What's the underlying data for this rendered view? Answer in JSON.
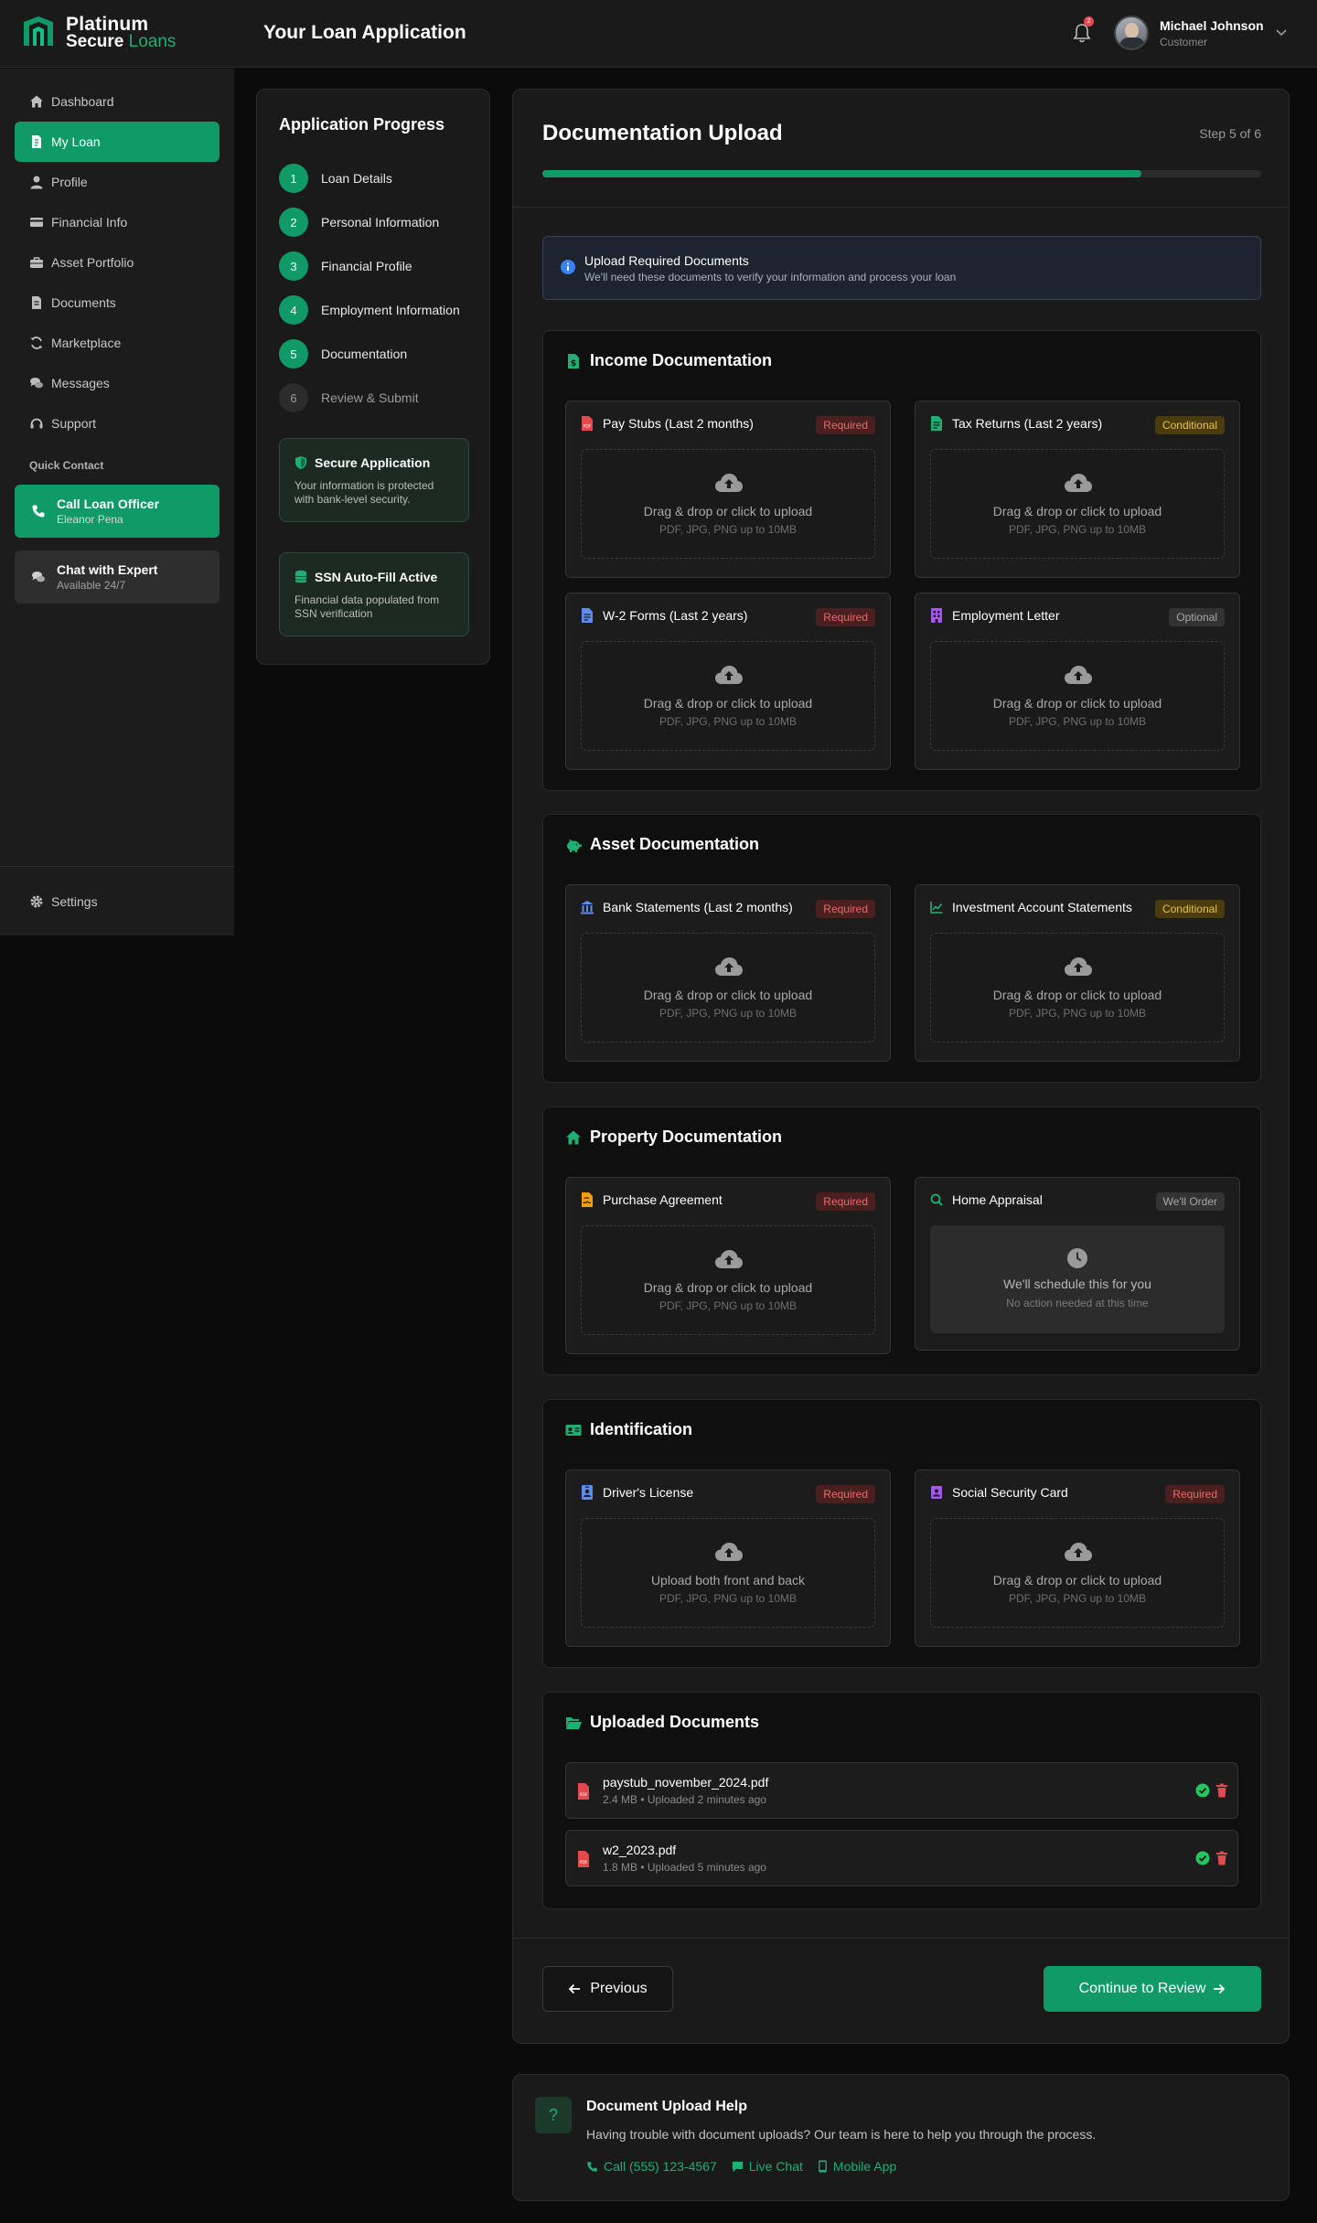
{
  "brand": {
    "line1": "Platinum",
    "line2_a": "Secure",
    "line2_b": "Loans",
    "accent_color": "#0f9a68"
  },
  "header": {
    "title": "Your Loan Application",
    "notification_count": "2"
  },
  "user": {
    "name": "Michael Johnson",
    "role": "Customer"
  },
  "sidebar": {
    "items": [
      {
        "label": "Dashboard",
        "icon": "home-icon"
      },
      {
        "label": "My Loan",
        "icon": "file-icon",
        "active": true
      },
      {
        "label": "Profile",
        "icon": "user-icon"
      },
      {
        "label": "Financial Info",
        "icon": "card-icon"
      },
      {
        "label": "Asset Portfolio",
        "icon": "briefcase-icon"
      },
      {
        "label": "Documents",
        "icon": "document-icon"
      },
      {
        "label": "Marketplace",
        "icon": "exchange-icon"
      },
      {
        "label": "Messages",
        "icon": "chat-icon"
      },
      {
        "label": "Support",
        "icon": "headset-icon"
      }
    ],
    "quick_contact_label": "Quick Contact",
    "call_officer": {
      "title": "Call Loan Officer",
      "sub": "Eleanor Pena"
    },
    "chat_expert": {
      "title": "Chat with Expert",
      "sub": "Available 24/7"
    },
    "settings_label": "Settings"
  },
  "progress": {
    "title": "Application Progress",
    "steps": [
      {
        "num": "1",
        "label": "Loan Details"
      },
      {
        "num": "2",
        "label": "Personal Information"
      },
      {
        "num": "3",
        "label": "Financial Profile"
      },
      {
        "num": "4",
        "label": "Employment Information"
      },
      {
        "num": "5",
        "label": "Documentation"
      },
      {
        "num": "6",
        "label": "Review & Submit"
      }
    ],
    "secure": {
      "title": "Secure Application",
      "text": "Your information is protected with bank-level security."
    },
    "ssn": {
      "title": "SSN Auto-Fill Active",
      "text": "Financial data populated from SSN verification"
    }
  },
  "form": {
    "title": "Documentation Upload",
    "step_text": "Step 5 of 6",
    "progress_fraction": 0.833,
    "notice": {
      "title": "Upload Required Documents",
      "text": "We'll need these documents to verify your information and process your loan"
    },
    "upload_text": "Drag & drop or click to upload",
    "upload_sub": "PDF, JPG, PNG up to 10MB",
    "sections": {
      "income": {
        "title": "Income Documentation",
        "docs": [
          {
            "label": "Pay Stubs (Last 2 months)",
            "badge": "Required"
          },
          {
            "label": "Tax Returns (Last 2 years)",
            "badge": "Conditional"
          },
          {
            "label": "W-2 Forms (Last 2 years)",
            "badge": "Required"
          },
          {
            "label": "Employment Letter",
            "badge": "Optional"
          }
        ]
      },
      "asset": {
        "title": "Asset Documentation",
        "docs": [
          {
            "label": "Bank Statements (Last 2 months)",
            "badge": "Required"
          },
          {
            "label": "Investment Account Statements",
            "badge": "Conditional"
          }
        ]
      },
      "property": {
        "title": "Property Documentation",
        "docs": [
          {
            "label": "Purchase Agreement",
            "badge": "Required"
          },
          {
            "label": "Home Appraisal",
            "badge": "We'll Order",
            "sched_text": "We'll schedule this for you",
            "sched_sub": "No action needed at this time"
          }
        ]
      },
      "identification": {
        "title": "Identification",
        "docs": [
          {
            "label": "Driver's License",
            "badge": "Required",
            "upload_text": "Upload both front and back"
          },
          {
            "label": "Social Security Card",
            "badge": "Required"
          }
        ]
      },
      "uploaded": {
        "title": "Uploaded Documents",
        "files": [
          {
            "name": "paystub_november_2024.pdf",
            "meta": "2.4 MB • Uploaded 2 minutes ago"
          },
          {
            "name": "w2_2023.pdf",
            "meta": "1.8 MB • Uploaded 5 minutes ago"
          }
        ]
      }
    },
    "prev_label": "Previous",
    "next_label": "Continue to Review"
  },
  "help": {
    "icon_glyph": "?",
    "title": "Document Upload Help",
    "text": "Having trouble with document uploads? Our team is here to help you through the process.",
    "links": [
      "Call (555) 123-4567",
      "Live Chat",
      "Mobile App"
    ]
  }
}
